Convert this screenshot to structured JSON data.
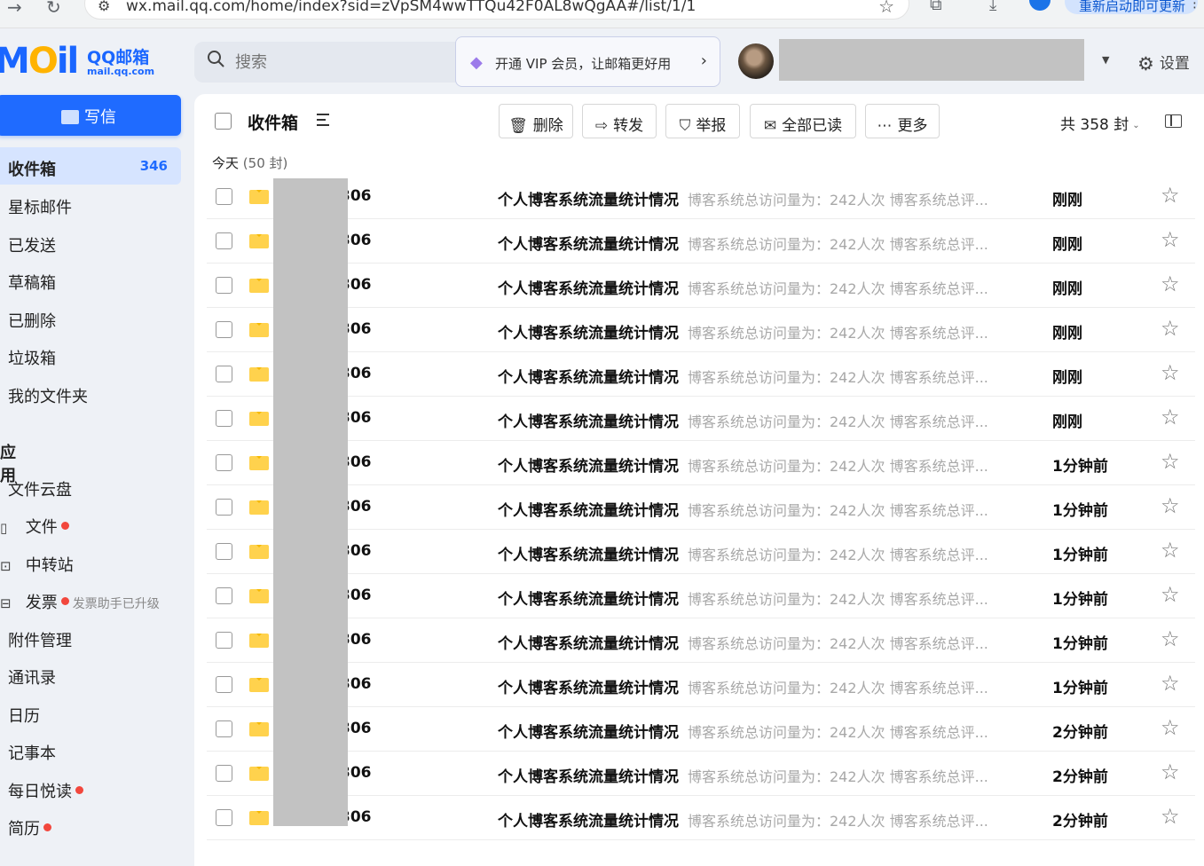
{
  "browser": {
    "url": "wx.mail.qq.com/home/index?sid=zVpSM4wwTTQu42F0AL8wQgAA#/list/1/1",
    "restart_label": "重新启动即可更新"
  },
  "logo": {
    "mark": "Mail",
    "brand": "QQ邮箱",
    "domain": "mail.qq.com"
  },
  "search": {
    "placeholder": "搜索"
  },
  "promo": {
    "text": "开通 VIP 会员，让邮箱更好用"
  },
  "header": {
    "settings_label": "设置"
  },
  "compose": {
    "label": "写信"
  },
  "sidebar": {
    "items": [
      {
        "label": "收件箱",
        "count": "346"
      },
      {
        "label": "星标邮件"
      },
      {
        "label": "已发送"
      },
      {
        "label": "草稿箱"
      },
      {
        "label": "已删除"
      },
      {
        "label": "垃圾箱"
      },
      {
        "label": "我的文件夹"
      }
    ],
    "section_label": "应用",
    "apps": [
      {
        "label": "文件云盘"
      },
      {
        "label": "文件"
      },
      {
        "label": "中转站"
      },
      {
        "label": "发票",
        "hint": "发票助手已升级"
      },
      {
        "label": "附件管理"
      },
      {
        "label": "通讯录"
      },
      {
        "label": "日历"
      },
      {
        "label": "记事本"
      },
      {
        "label": "每日悦读"
      },
      {
        "label": "简历"
      }
    ]
  },
  "toolbar": {
    "folder_title": "收件箱",
    "delete": "删除",
    "forward": "转发",
    "report": "举报",
    "mark_all_read": "全部已读",
    "more": "更多",
    "total": "共 358 封"
  },
  "group": {
    "label": "今天",
    "count": "(50 封)"
  },
  "emails": [
    {
      "sender": "306",
      "subject": "个人博客系统流量统计情况",
      "preview": "博客系统总访问量为：242人次 博客系统总评...",
      "time": "刚刚"
    },
    {
      "sender": "306",
      "subject": "个人博客系统流量统计情况",
      "preview": "博客系统总访问量为：242人次 博客系统总评...",
      "time": "刚刚"
    },
    {
      "sender": "306",
      "subject": "个人博客系统流量统计情况",
      "preview": "博客系统总访问量为：242人次 博客系统总评...",
      "time": "刚刚"
    },
    {
      "sender": "306",
      "subject": "个人博客系统流量统计情况",
      "preview": "博客系统总访问量为：242人次 博客系统总评...",
      "time": "刚刚"
    },
    {
      "sender": "306",
      "subject": "个人博客系统流量统计情况",
      "preview": "博客系统总访问量为：242人次 博客系统总评...",
      "time": "刚刚"
    },
    {
      "sender": "306",
      "subject": "个人博客系统流量统计情况",
      "preview": "博客系统总访问量为：242人次 博客系统总评...",
      "time": "刚刚"
    },
    {
      "sender": "306",
      "subject": "个人博客系统流量统计情况",
      "preview": "博客系统总访问量为：242人次 博客系统总评...",
      "time": "1分钟前"
    },
    {
      "sender": "306",
      "subject": "个人博客系统流量统计情况",
      "preview": "博客系统总访问量为：242人次 博客系统总评...",
      "time": "1分钟前"
    },
    {
      "sender": "306",
      "subject": "个人博客系统流量统计情况",
      "preview": "博客系统总访问量为：242人次 博客系统总评...",
      "time": "1分钟前"
    },
    {
      "sender": "306",
      "subject": "个人博客系统流量统计情况",
      "preview": "博客系统总访问量为：242人次 博客系统总评...",
      "time": "1分钟前"
    },
    {
      "sender": "306",
      "subject": "个人博客系统流量统计情况",
      "preview": "博客系统总访问量为：242人次 博客系统总评...",
      "time": "1分钟前"
    },
    {
      "sender": "306",
      "subject": "个人博客系统流量统计情况",
      "preview": "博客系统总访问量为：242人次 博客系统总评...",
      "time": "1分钟前"
    },
    {
      "sender": "306",
      "subject": "个人博客系统流量统计情况",
      "preview": "博客系统总访问量为：242人次 博客系统总评...",
      "time": "2分钟前"
    },
    {
      "sender": "306",
      "subject": "个人博客系统流量统计情况",
      "preview": "博客系统总访问量为：242人次 博客系统总评...",
      "time": "2分钟前"
    },
    {
      "sender": "306",
      "subject": "个人博客系统流量统计情况",
      "preview": "博客系统总访问量为：242人次 博客系统总评...",
      "time": "2分钟前"
    }
  ],
  "colors": {
    "accent": "#1f6bff",
    "active_bg": "#d6e4ff",
    "unread_dot": "#f2473d",
    "envelope": "#ffd24d"
  }
}
